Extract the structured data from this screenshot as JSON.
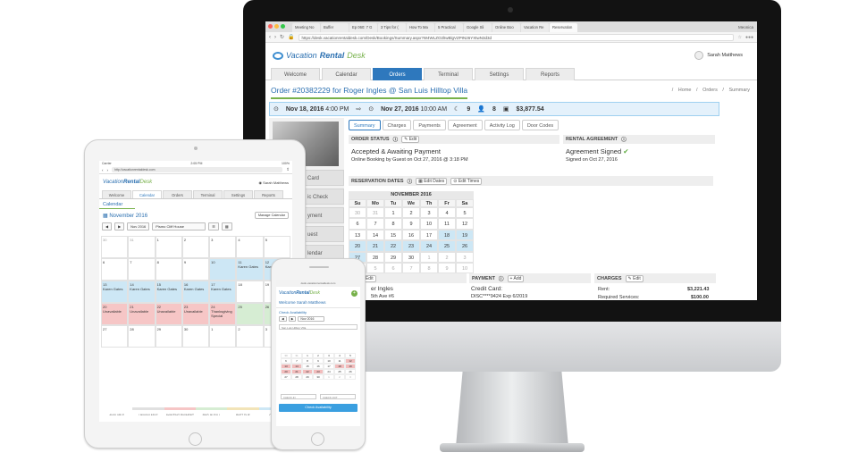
{
  "desktop": {
    "browser": {
      "tabs": [
        "Meeting No",
        "Buffer",
        "Ep 060: 7 G",
        "3 Tips for (",
        "How To Ma",
        "5 Practical",
        "Google Sli",
        "Online Boo",
        "Vacation Re",
        "Reservation"
      ],
      "corner_label": "Meonica",
      "url": "https://desk.vacationrentaldesk.com/Desk/Bookings/Summary.aspx?W4WLZO2lIwBlgVZPIN26YXtwN3d3d"
    },
    "logo": {
      "part1": "Vacation",
      "part2": "Rental",
      "part3": "Desk"
    },
    "user_name": "Sarah Matthews",
    "nav_tabs": [
      "Welcome",
      "Calendar",
      "Orders",
      "Terminal",
      "Settings",
      "Reports"
    ],
    "page_title": "Order #20382229 for Roger Ingles @ San Luis Hilltop Villa",
    "breadcrumb": {
      "home": "Home",
      "orders": "Orders",
      "current": "Summary",
      "sep": "/"
    },
    "datebar": {
      "checkin_date": "Nov 18, 2016",
      "checkin_time": "4:00 PM",
      "checkout_date": "Nov 27, 2016",
      "checkout_time": "10:00 AM",
      "nights": "9",
      "guests": "8",
      "total": "$3,877.54"
    },
    "left_menu": [
      "Card",
      "ic Check",
      "yment",
      "uest",
      "lendar"
    ],
    "sub_tabs": [
      "Summary",
      "Charges",
      "Payments",
      "Agreement",
      "Activity Log",
      "Door Codes"
    ],
    "order_status": {
      "header": "ORDER STATUS",
      "edit": "Edit",
      "status": "Accepted & Awaiting Payment",
      "detail": "Online Booking by Guest on Oct 27, 2016 @ 3:18 PM"
    },
    "agreement": {
      "header": "RENTAL AGREEMENT",
      "status": "Agreement Signed",
      "detail": "Signed on Oct 27, 2016"
    },
    "reservation_dates": {
      "header": "RESERVATION DATES",
      "edit_dates": "Edit Dates",
      "edit_times": "Edit Times"
    },
    "calendar": {
      "title": "NOVEMBER 2016",
      "dow": [
        "Su",
        "Mo",
        "Tu",
        "We",
        "Th",
        "Fr",
        "Sa"
      ],
      "days": [
        "30",
        "31",
        "1",
        "2",
        "3",
        "4",
        "5",
        "6",
        "7",
        "8",
        "9",
        "10",
        "11",
        "12",
        "13",
        "14",
        "15",
        "16",
        "17",
        "18",
        "19",
        "20",
        "21",
        "22",
        "23",
        "24",
        "25",
        "26",
        "27",
        "28",
        "29",
        "30",
        "1",
        "2",
        "3",
        "4",
        "5",
        "6",
        "7",
        "8",
        "9",
        "10"
      ]
    },
    "guest": {
      "header": "T",
      "edit": "Edit",
      "name": "er Ingles",
      "address": "5th Ave #6"
    },
    "payment": {
      "header": "PAYMENT",
      "add": "Add",
      "label": "Credit Card:",
      "card": "DISC****9424 Exp 6/2019"
    },
    "charges": {
      "header": "CHARGES",
      "edit": "Edit",
      "rent_label": "Rent:",
      "rent_value": "$3,221.43",
      "service_label": "Required Services:",
      "service_value": "$100.00"
    }
  },
  "tablet": {
    "status_left": "Carrier",
    "status_time": "2:05 PM",
    "status_right": "100%",
    "url": "http://vacationrentaldesk.com",
    "logo": {
      "part1": "Vacation",
      "part2": "Rental",
      "part3": "Desk"
    },
    "user_name": "Sarah Matthews",
    "tabs": [
      "Welcome",
      "Calendar",
      "Orders",
      "Terminal",
      "Settings",
      "Reports"
    ],
    "section": "Calendar",
    "month": "November 2016",
    "manage": "Manage Calendar",
    "month_select": "Nov 2016",
    "property": "Pismo Cliff House",
    "cells": [
      "30",
      "31",
      "1",
      "2",
      "3",
      "4",
      "5",
      "6",
      "7",
      "8",
      "9",
      "10",
      "11\nKaren Gates",
      "12\nKaren Gates",
      "13\nKaren Gates",
      "14\nKaren Gates",
      "15\nKaren Gates",
      "16\nKaren Gates",
      "17\nKaren Gates",
      "18",
      "19",
      "20\nUnavailable",
      "21\nUnavailable",
      "22\nUnavailable",
      "23\nUnavailable",
      "24\nThanksgiving\nSpecial",
      "25",
      "26",
      "27",
      "28",
      "29",
      "30",
      "1",
      "2",
      "3"
    ],
    "legend": [
      "AVAILABLE",
      "UNAVAILABLE",
      "AWAITING PAYMENT",
      "PAID IN FULL",
      "PAST DUE",
      "OWNER"
    ]
  },
  "phone": {
    "url": "desk.vacationrentaldesk.com",
    "logo": {
      "part1": "Vacation",
      "part2": "Rental",
      "part3": "Desk"
    },
    "welcome": "Welcome Sarah Matthews",
    "check_heading": "Check Availability",
    "month_select": "Nov 2016",
    "property": "San Luis Hilltop Villa",
    "checkin_placeholder": "CHECK-IN",
    "checkout_placeholder": "CHECK-OUT",
    "cta": "Check Availability",
    "cells": [
      "30",
      "31",
      "1",
      "2",
      "3",
      "4",
      "5",
      "6",
      "7",
      "8",
      "9",
      "10",
      "11",
      "12",
      "13",
      "14",
      "15",
      "16",
      "17",
      "18",
      "19",
      "20",
      "21",
      "22",
      "23",
      "24",
      "25",
      "26",
      "27",
      "28",
      "29",
      "30",
      "1",
      "2",
      "3"
    ]
  },
  "colors": {
    "brand_blue": "#2e78bd",
    "brand_green": "#77b14a",
    "booked_blue": "#cde7f5",
    "unavailable_red": "#f6c6c6",
    "paid_green": "#d6edd3"
  },
  "icons": [
    "calendar-icon",
    "moon-icon",
    "guests-icon",
    "money-icon",
    "pencil-icon",
    "check-icon",
    "info-icon",
    "user-icon",
    "plus-icon",
    "home-button-icon"
  ]
}
